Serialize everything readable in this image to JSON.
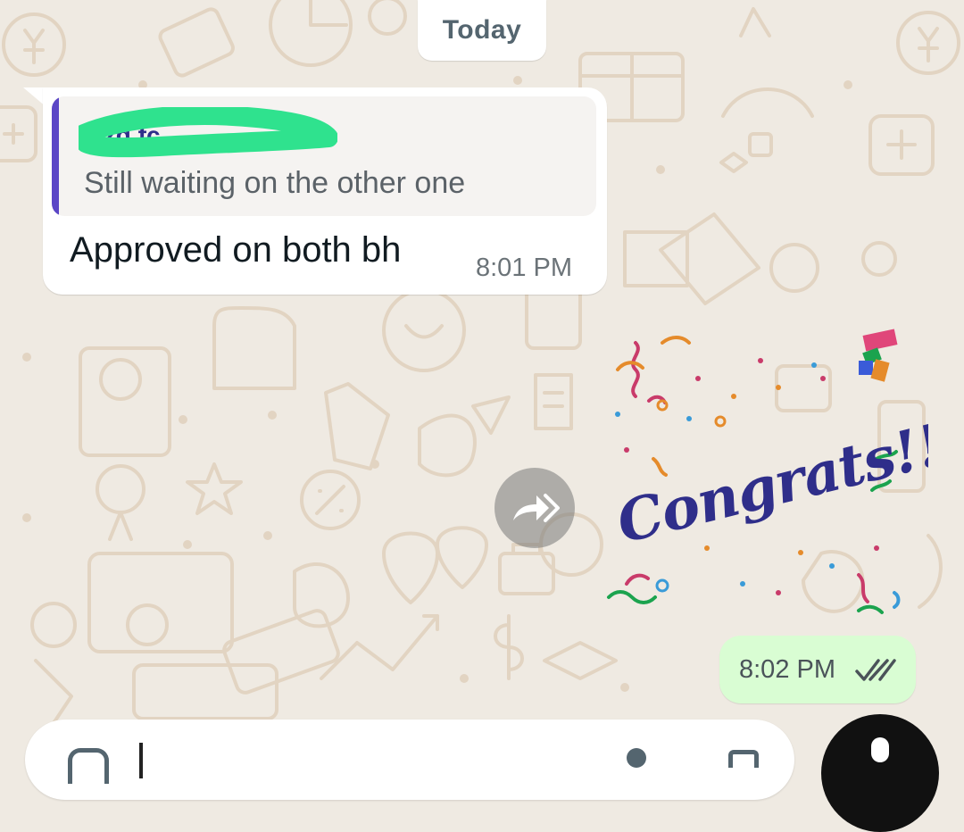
{
  "date_separator": "Today",
  "incoming_message": {
    "quoted": {
      "author": "Ozg fc",
      "text": "Still waiting on the other one"
    },
    "text": "Approved on both bh",
    "time": "8:01 PM"
  },
  "sticker": {
    "text": "Congrats!!!"
  },
  "outgoing_message": {
    "time": "8:02 PM",
    "status": "read"
  },
  "colors": {
    "chat_background": "#efeae2",
    "incoming_bubble": "#ffffff",
    "outgoing_bubble": "#d9fdd3",
    "quote_bar": "#5b46c6",
    "read_ticks": "#4a5359",
    "sticker_text": "#2f2e8a"
  },
  "icons": {
    "forward": "forward-arrow-icon",
    "ticks": "double-check-icon",
    "mic": "microphone-icon"
  }
}
